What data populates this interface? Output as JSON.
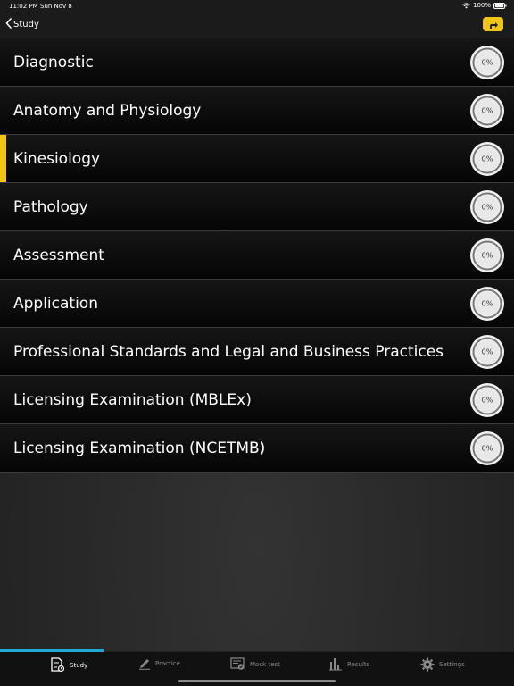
{
  "status_bar": {
    "time": "11:02 PM",
    "date": "Sun Nov 8",
    "battery": "100%"
  },
  "nav": {
    "back_label": "Study",
    "back_icon": "chevron-left-icon",
    "share_icon": "share-arrow-icon",
    "accent": "#f0c419"
  },
  "list": {
    "items": [
      {
        "label": "Diagnostic",
        "progress": "0%"
      },
      {
        "label": "Anatomy and Physiology",
        "progress": "0%"
      },
      {
        "label": "Kinesiology",
        "progress": "0%"
      },
      {
        "label": "Pathology",
        "progress": "0%"
      },
      {
        "label": "Assessment",
        "progress": "0%"
      },
      {
        "label": "Application",
        "progress": "0%"
      },
      {
        "label": "Professional Standards and Legal and Business Practices",
        "progress": "0%"
      },
      {
        "label": "Licensing Examination (MBLEx)",
        "progress": "0%"
      },
      {
        "label": "Licensing Examination (NCETMB)",
        "progress": "0%"
      }
    ],
    "selected_index": 2,
    "selected_color": "#f2c511"
  },
  "tabs": [
    {
      "label": "Study",
      "icon": "study-icon"
    },
    {
      "label": "Practice",
      "icon": "pencil-icon"
    },
    {
      "label": "Mock test",
      "icon": "mock-test-icon"
    },
    {
      "label": "Results",
      "icon": "bar-chart-icon"
    },
    {
      "label": "Settings",
      "icon": "gear-icon"
    }
  ],
  "active_tab_color": "#1fa8d8"
}
